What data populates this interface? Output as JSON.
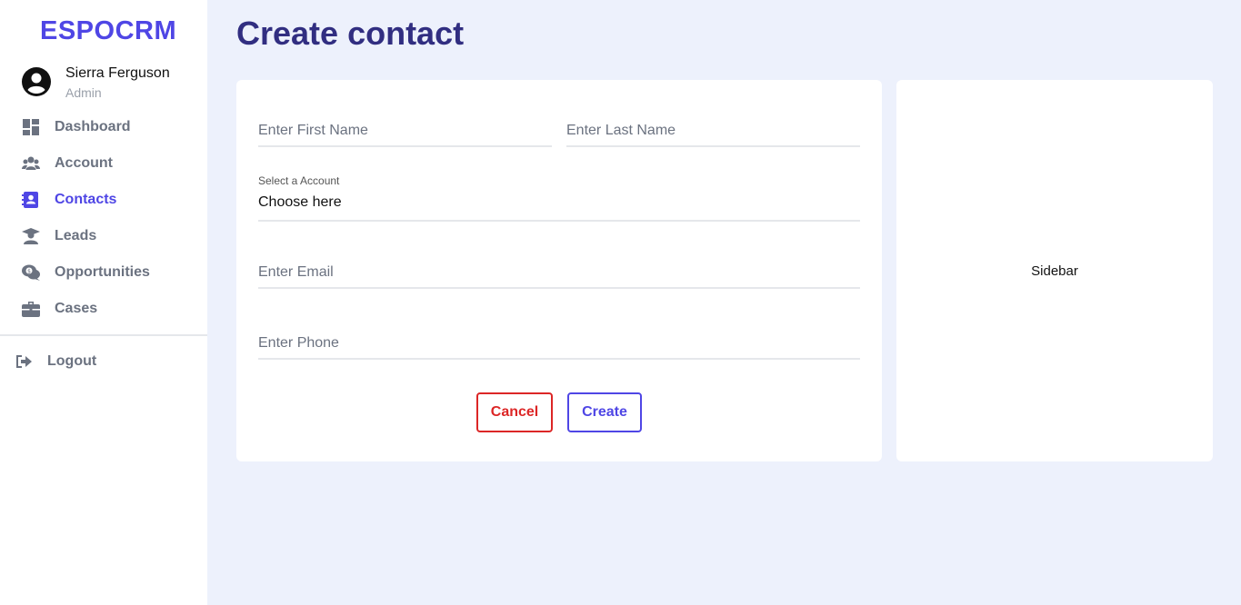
{
  "brand": "ESPOCRM",
  "user": {
    "name": "Sierra Ferguson",
    "role": "Admin"
  },
  "nav": {
    "items": [
      {
        "label": "Dashboard",
        "icon": "dashboard-icon",
        "active": false
      },
      {
        "label": "Account",
        "icon": "users-icon",
        "active": false
      },
      {
        "label": "Contacts",
        "icon": "address-book-icon",
        "active": true
      },
      {
        "label": "Leads",
        "icon": "graduate-icon",
        "active": false
      },
      {
        "label": "Opportunities",
        "icon": "money-chat-icon",
        "active": false
      },
      {
        "label": "Cases",
        "icon": "briefcase-icon",
        "active": false
      }
    ],
    "logout_label": "Logout"
  },
  "page": {
    "title": "Create contact"
  },
  "form": {
    "first_name": {
      "placeholder": "Enter First Name",
      "value": ""
    },
    "last_name": {
      "placeholder": "Enter Last Name",
      "value": ""
    },
    "account": {
      "label": "Select a Account",
      "value": "Choose here"
    },
    "email": {
      "placeholder": "Enter Email",
      "value": ""
    },
    "phone": {
      "placeholder": "Enter Phone",
      "value": ""
    },
    "cancel_label": "Cancel",
    "create_label": "Create"
  },
  "side_panel": {
    "text": "Sidebar"
  },
  "colors": {
    "accent": "#4f46e5",
    "title": "#312e81",
    "danger": "#dc2626",
    "background": "#edf1fc"
  }
}
